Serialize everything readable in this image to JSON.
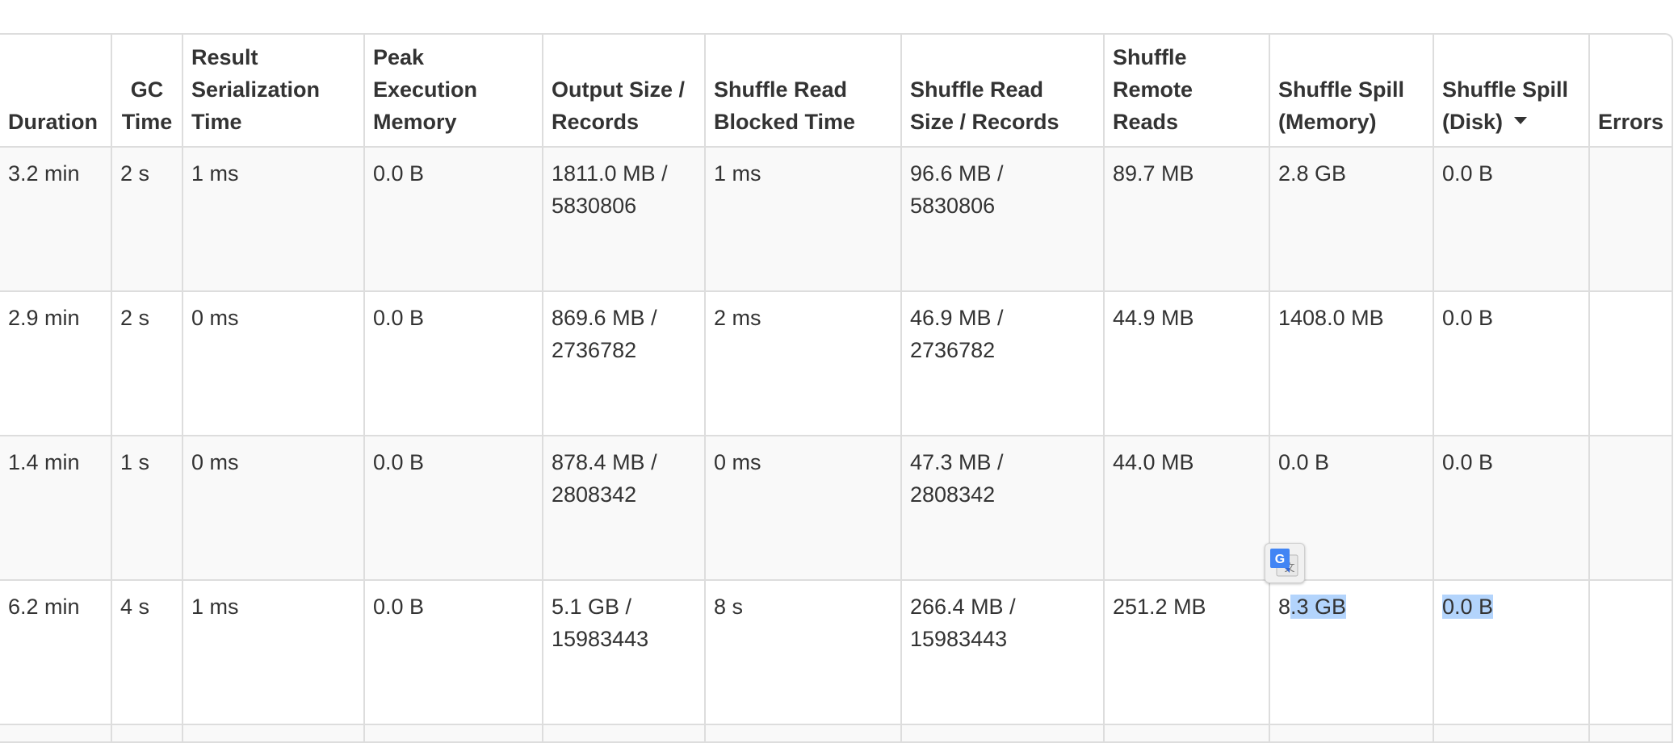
{
  "table": {
    "headers": [
      {
        "key": "duration",
        "lines": [
          "Duration"
        ]
      },
      {
        "key": "gc_time",
        "lines": [
          "GC",
          "Time"
        ],
        "center": true
      },
      {
        "key": "result_serialization_time",
        "lines": [
          "Result",
          "Serialization",
          "Time"
        ]
      },
      {
        "key": "peak_execution_memory",
        "lines": [
          "Peak",
          "Execution",
          "Memory"
        ]
      },
      {
        "key": "output_size_records",
        "lines": [
          "Output Size /",
          "Records"
        ]
      },
      {
        "key": "shuffle_read_blocked_time",
        "lines": [
          "Shuffle Read",
          "Blocked Time"
        ]
      },
      {
        "key": "shuffle_read_size_records",
        "lines": [
          "Shuffle Read",
          "Size / Records"
        ]
      },
      {
        "key": "shuffle_remote_reads",
        "lines": [
          "Shuffle",
          "Remote",
          "Reads"
        ]
      },
      {
        "key": "shuffle_spill_memory",
        "lines": [
          "Shuffle Spill",
          "(Memory)"
        ]
      },
      {
        "key": "shuffle_spill_disk",
        "lines": [
          "Shuffle Spill",
          "(Disk)"
        ],
        "sorted": "desc"
      },
      {
        "key": "errors",
        "lines": [
          "Errors"
        ]
      }
    ],
    "rows": [
      [
        "3.2 min",
        "2 s",
        "1 ms",
        "0.0 B",
        [
          "1811.0 MB /",
          "5830806"
        ],
        "1 ms",
        [
          "96.6 MB /",
          "5830806"
        ],
        "89.7 MB",
        "2.8 GB",
        "0.0 B",
        ""
      ],
      [
        "2.9 min",
        "2 s",
        "0 ms",
        "0.0 B",
        [
          "869.6 MB /",
          "2736782"
        ],
        "2 ms",
        [
          "46.9 MB /",
          "2736782"
        ],
        "44.9 MB",
        "1408.0 MB",
        "0.0 B",
        ""
      ],
      [
        "1.4 min",
        "1 s",
        "0 ms",
        "0.0 B",
        [
          "878.4 MB /",
          "2808342"
        ],
        "0 ms",
        [
          "47.3 MB /",
          "2808342"
        ],
        "44.0 MB",
        "0.0 B",
        "0.0 B",
        ""
      ],
      [
        "6.2 min",
        "4 s",
        "1 ms",
        "0.0 B",
        [
          "5.1 GB /",
          "15983443"
        ],
        "8 s",
        [
          "266.4 MB /",
          "15983443"
        ],
        "251.2 MB",
        "8.3 GB",
        "0.0 B",
        ""
      ]
    ]
  },
  "selection": {
    "spill_memory_prefix": "8",
    "spill_memory_selected": ".3 GB",
    "spill_disk_selected": "0.0 B"
  },
  "translate_badge": {
    "icon": "google-translate-icon",
    "colors": {
      "blue": "#4285f4",
      "gray": "#e8e8e8"
    }
  },
  "colors": {
    "text": "#333333",
    "border": "#dddddd",
    "row_striped": "#f9f9f9",
    "selection": "#b3d4fc"
  }
}
